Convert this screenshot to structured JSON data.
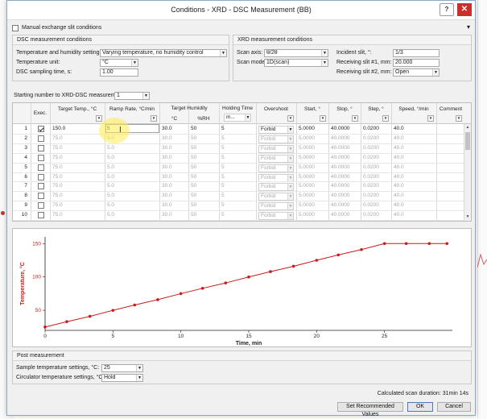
{
  "window": {
    "title": "Conditions - XRD - DSC Measurement (BB)",
    "help_glyph": "?",
    "close_glyph": "✕"
  },
  "manual_exchange": {
    "label": "Manual exchange slit conditions",
    "checked": false
  },
  "dsc": {
    "title": "DSC measurement conditions",
    "temp_humidity_label": "Temperature and humidity setting:",
    "temp_humidity_value": "Varying temperature, no humidity control",
    "temp_unit_label": "Temperature unit:",
    "temp_unit_value": "°C",
    "sampling_label": "DSC sampling time, s:",
    "sampling_value": "1.00"
  },
  "xrd": {
    "title": "XRD measurement conditions",
    "scan_axis_label": "Scan axis:",
    "scan_axis_value": "θ/2θ",
    "scan_mode_label": "Scan mode:",
    "scan_mode_value": "1D(scan)",
    "incident_label": "Incident slit, °:",
    "incident_value": "1/3",
    "recv1_label": "Receiving slit #1, mm:",
    "recv1_value": "20.000",
    "recv2_label": "Receiving slit #2, mm:",
    "recv2_value": "Open"
  },
  "starting_number": {
    "label": "Starting number to XRD-DSC measurement:",
    "value": "1"
  },
  "table": {
    "headers": {
      "exec": "Exec.",
      "target_temp": "Target Temp., °C",
      "ramp_rate": "Ramp Rate, °C/min",
      "target_humidity": "Target Humidity",
      "hum_c": "°C",
      "hum_rh": "%RH",
      "holding_time": "Holding Time",
      "holding_unit": "m...",
      "overshoot": "Overshoot",
      "start": "Start, °",
      "stop": "Stop, °",
      "step": "Step, °",
      "speed": "Speed, °/min",
      "comment": "Comment"
    },
    "rows": [
      {
        "n": "1",
        "checked": true,
        "temp": "150.0",
        "ramp": "5",
        "hc": "30.0",
        "rh": "50",
        "hold": "5",
        "over": "Forbid",
        "start": "5.0000",
        "stop": "40.0000",
        "step": "0.0200",
        "speed": "40.0",
        "active": true
      },
      {
        "n": "2",
        "checked": false,
        "temp": "75.0",
        "ramp": "5.0",
        "hc": "30.0",
        "rh": "50",
        "hold": "5",
        "over": "Forbid",
        "start": "5.0000",
        "stop": "40.0000",
        "step": "0.0200",
        "speed": "40.0",
        "active": false
      },
      {
        "n": "3",
        "checked": false,
        "temp": "75.0",
        "ramp": "5.0",
        "hc": "30.0",
        "rh": "50",
        "hold": "5",
        "over": "Forbid",
        "start": "5.0000",
        "stop": "40.0000",
        "step": "0.0200",
        "speed": "40.0",
        "active": false
      },
      {
        "n": "4",
        "checked": false,
        "temp": "75.0",
        "ramp": "5.0",
        "hc": "30.0",
        "rh": "50",
        "hold": "5",
        "over": "Forbid",
        "start": "5.0000",
        "stop": "40.0000",
        "step": "0.0200",
        "speed": "40.0",
        "active": false
      },
      {
        "n": "5",
        "checked": false,
        "temp": "75.0",
        "ramp": "5.0",
        "hc": "30.0",
        "rh": "50",
        "hold": "5",
        "over": "Forbid",
        "start": "5.0000",
        "stop": "40.0000",
        "step": "0.0200",
        "speed": "40.0",
        "active": false
      },
      {
        "n": "6",
        "checked": false,
        "temp": "75.0",
        "ramp": "5.0",
        "hc": "30.0",
        "rh": "50",
        "hold": "5",
        "over": "Forbid",
        "start": "5.0000",
        "stop": "40.0000",
        "step": "0.0200",
        "speed": "40.0",
        "active": false
      },
      {
        "n": "7",
        "checked": false,
        "temp": "75.0",
        "ramp": "5.0",
        "hc": "30.0",
        "rh": "50",
        "hold": "5",
        "over": "Forbid",
        "start": "5.0000",
        "stop": "40.0000",
        "step": "0.0200",
        "speed": "40.0",
        "active": false
      },
      {
        "n": "8",
        "checked": false,
        "temp": "75.0",
        "ramp": "5.0",
        "hc": "30.0",
        "rh": "50",
        "hold": "5",
        "over": "Forbid",
        "start": "5.0000",
        "stop": "40.0000",
        "step": "0.0200",
        "speed": "40.0",
        "active": false
      },
      {
        "n": "9",
        "checked": false,
        "temp": "75.0",
        "ramp": "5.0",
        "hc": "30.0",
        "rh": "50",
        "hold": "5",
        "over": "Forbid",
        "start": "5.0000",
        "stop": "40.0000",
        "step": "0.0200",
        "speed": "40.0",
        "active": false
      },
      {
        "n": "10",
        "checked": false,
        "temp": "75.0",
        "ramp": "5.0",
        "hc": "30.0",
        "rh": "50",
        "hold": "5",
        "over": "Forbid",
        "start": "5.0000",
        "stop": "40.0000",
        "step": "0.0200",
        "speed": "40.0",
        "active": false
      }
    ]
  },
  "chart_data": {
    "type": "line",
    "title": "",
    "xlabel": "Time, min",
    "ylabel": "Temperature, °C",
    "xlim": [
      0,
      30
    ],
    "ylim": [
      20,
      160
    ],
    "x_ticks": [
      0,
      5,
      10,
      15,
      20,
      25
    ],
    "y_ticks": [
      50,
      100,
      150
    ],
    "grid": false,
    "color": "#cc1a1a",
    "points": [
      [
        0,
        25
      ],
      [
        1.6,
        33
      ],
      [
        3.3,
        41
      ],
      [
        5,
        50
      ],
      [
        6.6,
        58
      ],
      [
        8.3,
        66
      ],
      [
        10,
        75
      ],
      [
        11.6,
        83
      ],
      [
        13.3,
        91
      ],
      [
        15,
        100
      ],
      [
        16.6,
        108
      ],
      [
        18.3,
        116
      ],
      [
        20,
        125
      ],
      [
        21.6,
        133
      ],
      [
        23.3,
        141
      ],
      [
        25,
        150
      ],
      [
        26.6,
        150
      ],
      [
        28.3,
        150
      ],
      [
        29.6,
        150
      ]
    ]
  },
  "post": {
    "title": "Post measurement",
    "sample_label": "Sample temperature settings, °C:",
    "sample_value": "25",
    "circulator_label": "Circulator temperature settings, °C:",
    "circulator_value": "Hold"
  },
  "footer": {
    "scan_duration": "Calculated scan duration: 31min 14s",
    "recommend_label": "Set Recommended Values",
    "ok_label": "OK",
    "cancel_label": "Cancel"
  }
}
